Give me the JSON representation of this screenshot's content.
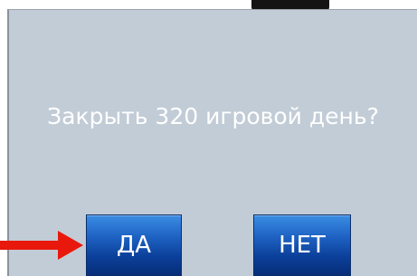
{
  "dialog": {
    "message": "Закрыть 320 игровой день?",
    "yes_label": "ДА",
    "no_label": "НЕТ"
  },
  "colors": {
    "dialog_background": "#c2ccd6",
    "button_top": "#3a8de3",
    "button_bottom": "#072e78",
    "arrow": "#e8180c",
    "text": "#ffffff"
  },
  "icons": {
    "pointer": "arrow-right-icon"
  }
}
